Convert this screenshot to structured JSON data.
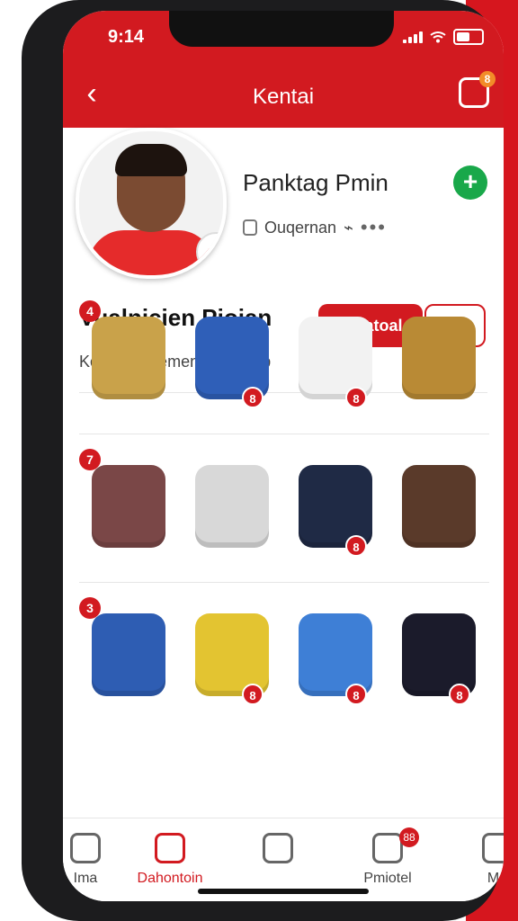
{
  "status": {
    "time": "9:14"
  },
  "header": {
    "title": "Kentai",
    "edit_badge": "8"
  },
  "profile": {
    "name": "Panktag Pmin",
    "meta": {
      "text": "Ouqernan",
      "dots": "•••"
    },
    "handle": "Vualnicien Piojan",
    "primary_button": "Holatoal",
    "secondary_button": "☺",
    "subtitle": "Koklecdidhemenik Borianb",
    "add_button": "+"
  },
  "collection": [
    [
      {
        "label": "4",
        "color": "#c9a24a",
        "count": ""
      },
      {
        "label": "",
        "color": "#2f5fb8",
        "count": "8"
      },
      {
        "label": "",
        "color": "#f2f2f2",
        "count": "8"
      },
      {
        "label": "",
        "color": "#b98a35",
        "count": ""
      }
    ],
    [
      {
        "label": "7",
        "color": "#7a4747",
        "count": ""
      },
      {
        "label": "",
        "color": "#d8d8d8",
        "count": ""
      },
      {
        "label": "",
        "color": "#1f2a45",
        "count": "8"
      },
      {
        "label": "",
        "color": "#5a3a2a",
        "count": ""
      }
    ],
    [
      {
        "label": "3",
        "color": "#2e5db3",
        "count": ""
      },
      {
        "label": "",
        "color": "#e3c431",
        "count": "8"
      },
      {
        "label": "",
        "color": "#3e7fd6",
        "count": "8"
      },
      {
        "label": "",
        "color": "#1b1b2b",
        "count": "8"
      }
    ]
  ],
  "bottom_nav": [
    {
      "label": "Ima",
      "icon": "person-icon"
    },
    {
      "label": "Dahontoin",
      "icon": "home-icon"
    },
    {
      "label": "",
      "icon": "box-icon"
    },
    {
      "label": "Pmiotel",
      "icon": "search-icon",
      "badge": "88"
    },
    {
      "label": "Mo",
      "icon": "home-icon"
    }
  ],
  "colors": {
    "brand_red": "#d21a20",
    "accent_green": "#19a84a"
  }
}
